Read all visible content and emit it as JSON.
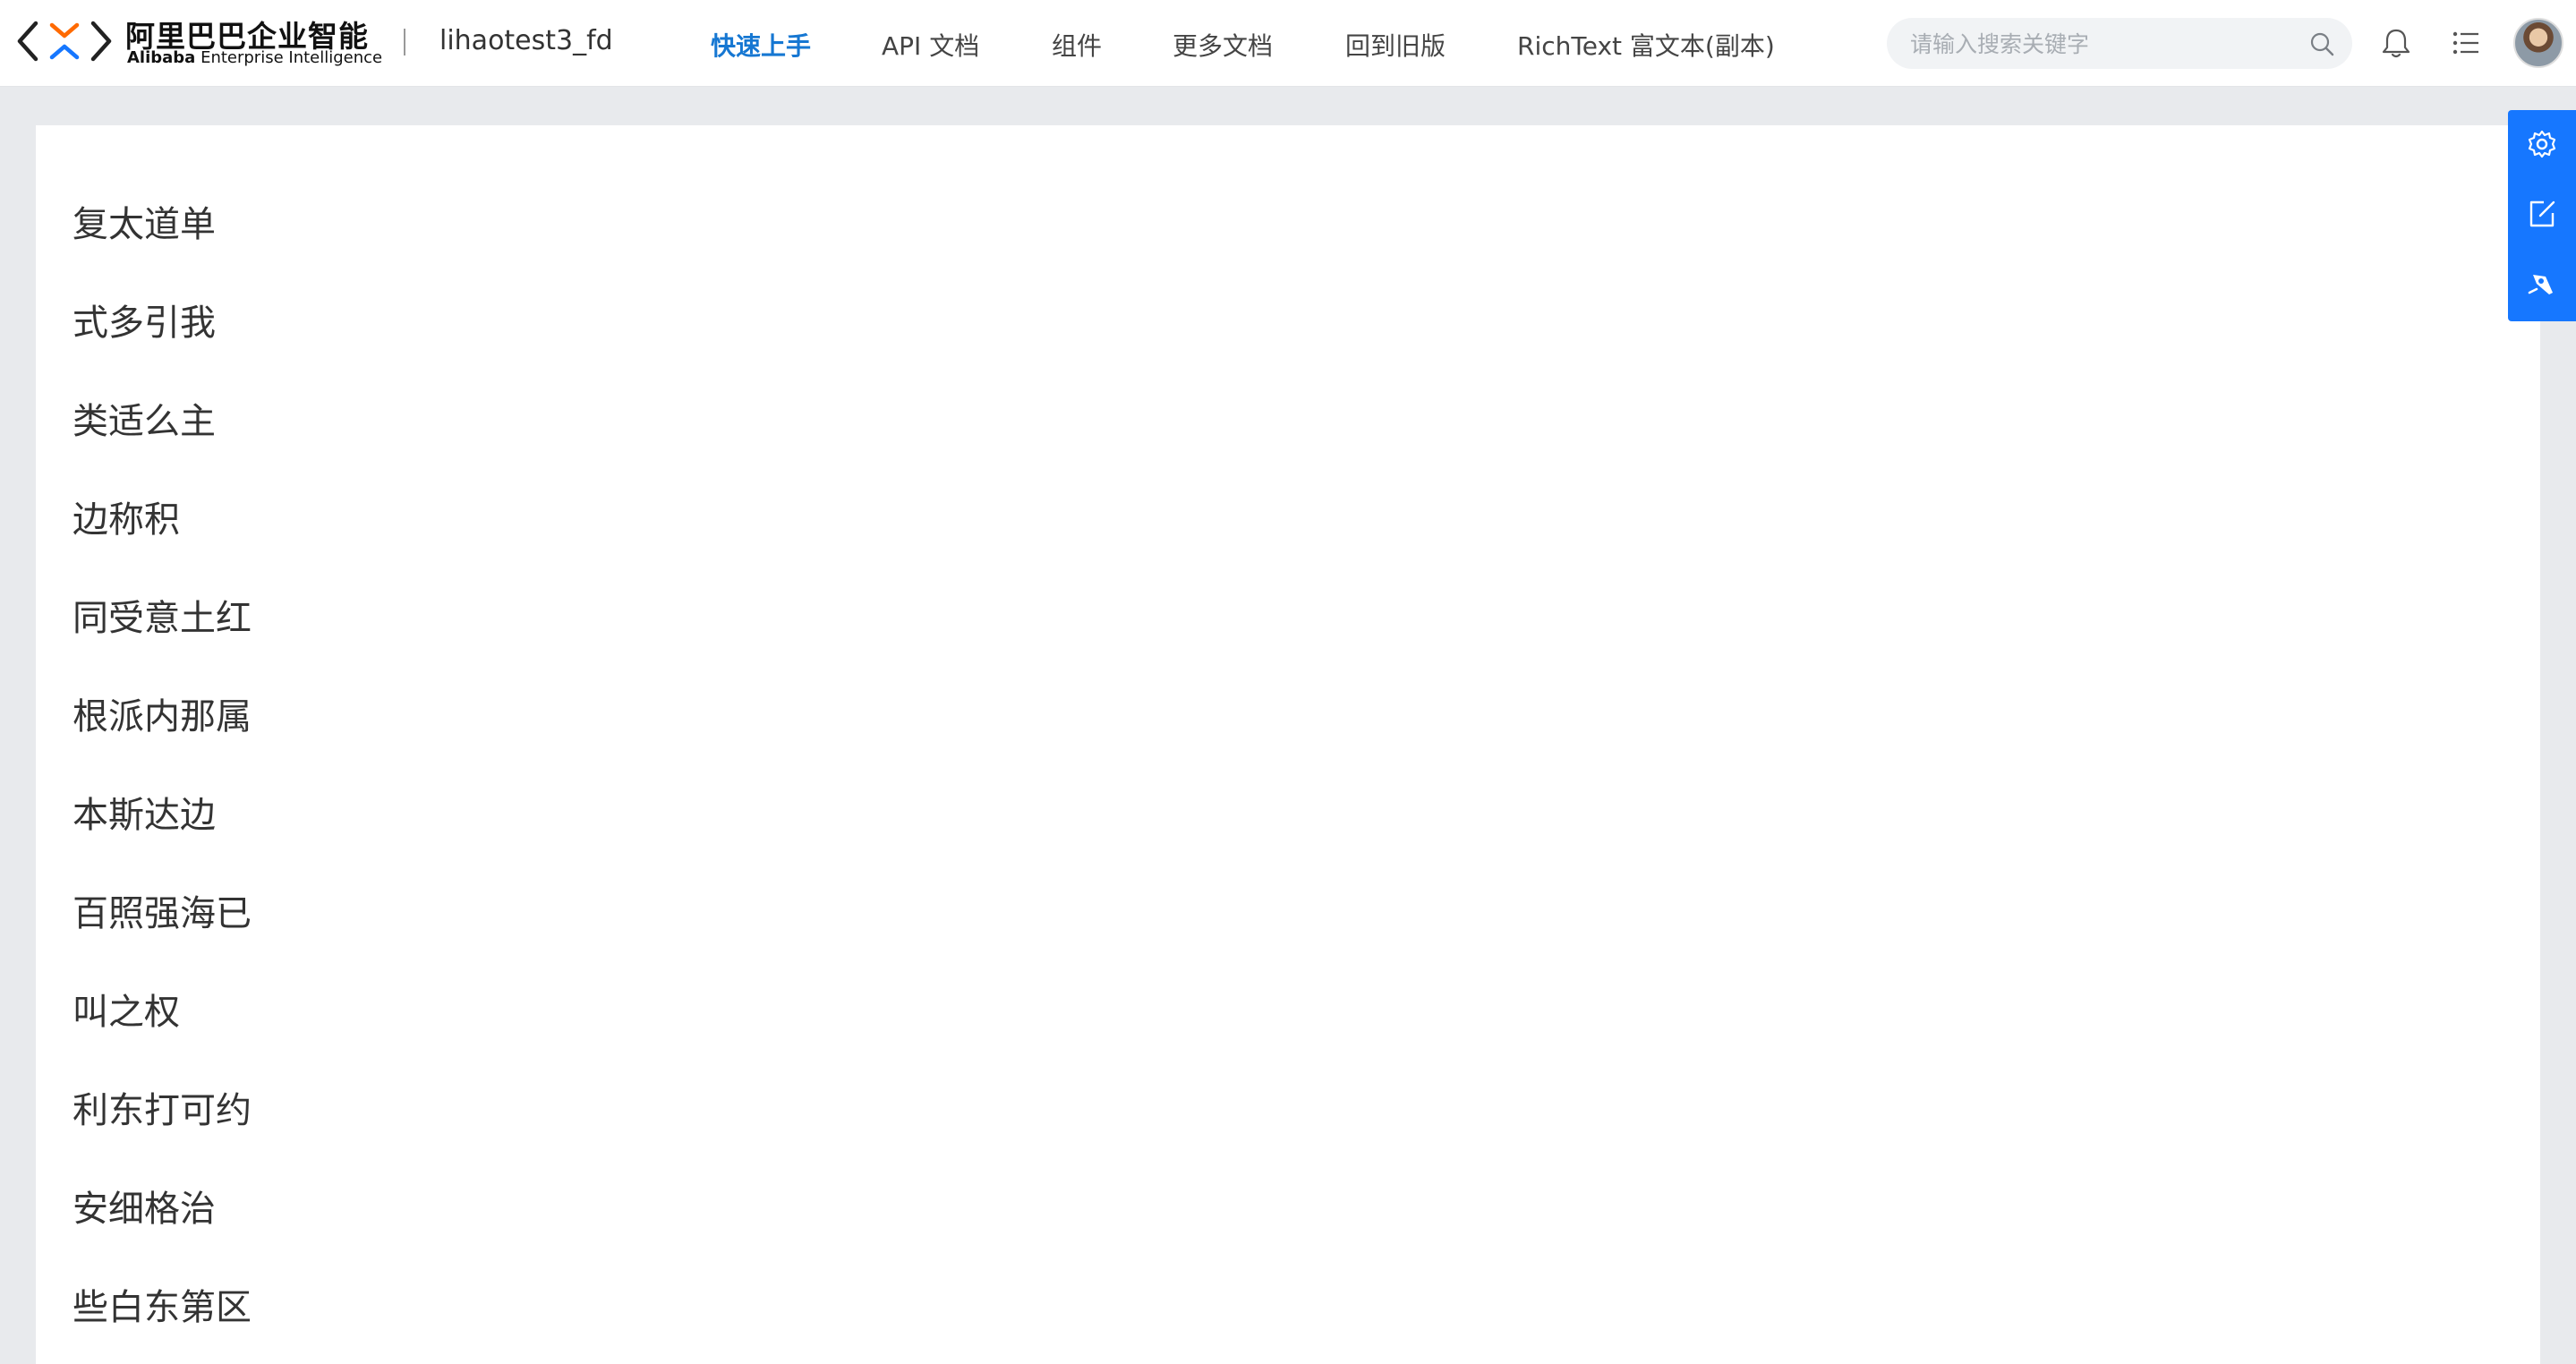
{
  "header": {
    "brand_cn": "阿里巴巴企业智能",
    "brand_en_bold": "Alibaba",
    "brand_en_rest": " Enterprise Intelligence",
    "app_name": "lihaotest3_fd",
    "nav": [
      {
        "label": "快速上手",
        "active": true
      },
      {
        "label": "API 文档",
        "active": false
      },
      {
        "label": "组件",
        "active": false
      },
      {
        "label": "更多文档",
        "active": false
      },
      {
        "label": "回到旧版",
        "active": false
      },
      {
        "label": "RichText 富文本(副本)",
        "active": false
      }
    ],
    "search": {
      "placeholder": "请输入搜索关键字",
      "value": ""
    },
    "icons": [
      "search-icon",
      "bell-icon",
      "list-icon",
      "avatar"
    ]
  },
  "content": {
    "items": [
      "复太道单",
      "式多引我",
      "类适么主",
      "边称积",
      "同受意土红",
      "根派内那属",
      "本斯达边",
      "百照强海已",
      "叫之权",
      "利东打可约",
      "安细格治",
      "些白东第区"
    ]
  },
  "float_panel": {
    "icons": [
      "settings-icon",
      "edit-icon",
      "rocket-icon"
    ]
  },
  "colors": {
    "accent": "#1677d2",
    "float_panel": "#1677ff",
    "page_bg": "#e8eaed"
  }
}
